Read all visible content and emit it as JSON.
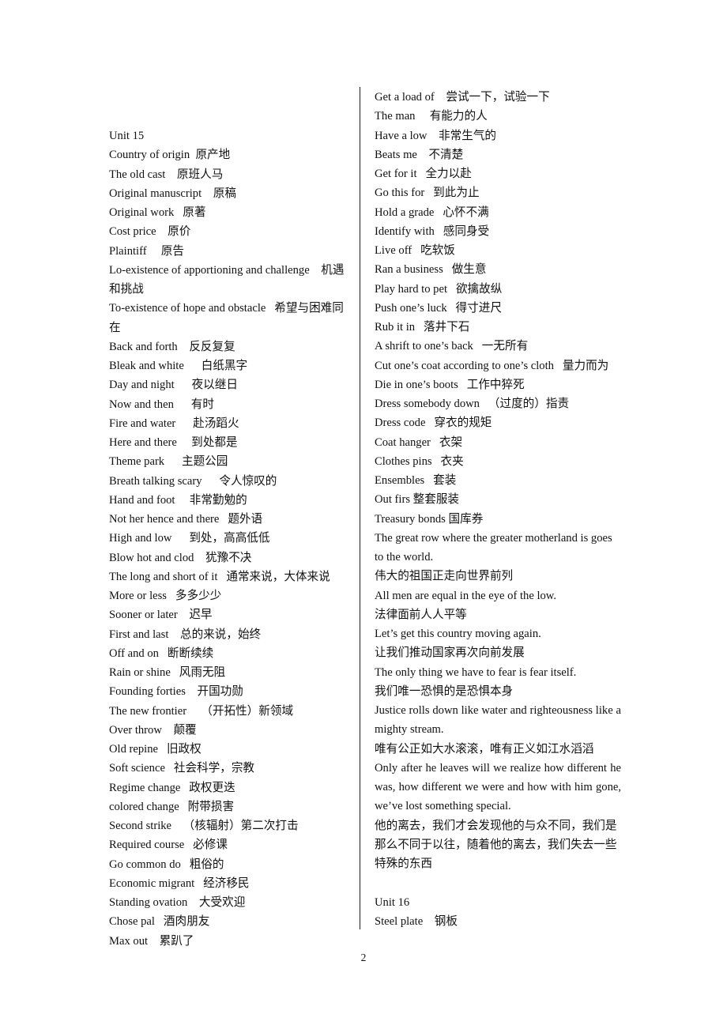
{
  "document": {
    "page_number": "2",
    "columns": {
      "left": {
        "heading": "Unit 15",
        "entries": [
          "Unit 15",
          "Country of origin  原产地",
          "The old cast    原班人马",
          "Original manuscript    原稿",
          "Original work   原著",
          "Cost price    原价",
          "Plaintiff     原告",
          "Lo-existence of apportioning and challenge    机遇和挑战",
          "To-existence of hope and obstacle   希望与困难同在",
          "Back and forth    反反复复",
          "Bleak and white      白纸黑字",
          "Day and night      夜以继日",
          "Now and then      有时",
          "Fire and water      赴汤蹈火",
          "Here and there     到处都是",
          "Theme park      主题公园",
          "Breath talking scary      令人惊叹的",
          "Hand and foot     非常勤勉的",
          "Not her hence and there   题外语",
          "High and low      到处，高高低低",
          "Blow hot and clod    犹豫不决",
          "The long and short of it   通常来说，大体来说",
          "More or less   多多少少",
          "Sooner or later    迟早",
          "First and last    总的来说，始终",
          "Off and on   断断续续",
          "Rain or shine   风雨无阻",
          "Founding forties    开国功勋",
          "The new frontier     （开拓性）新领域",
          "Over throw    颠覆",
          "Old repine   旧政权",
          "Soft science   社会科学，宗教",
          "Regime change   政权更迭",
          "colored change   附带损害",
          "Second strike    （核辐射）第二次打击",
          "Required course   必修课",
          "Go common do   粗俗的",
          "Economic migrant   经济移民",
          "Standing ovation    大受欢迎",
          "Chose pal   酒肉朋友",
          "Max out    累趴了"
        ]
      },
      "right": {
        "heading": "Unit 16",
        "entries": [
          {
            "type": "line",
            "text": "Get a load of    尝试一下，试验一下"
          },
          {
            "type": "line",
            "text": "The man     有能力的人"
          },
          {
            "type": "line",
            "text": "Have a low    非常生气的"
          },
          {
            "type": "line",
            "text": "Beats me    不清楚"
          },
          {
            "type": "line",
            "text": "Get for it   全力以赴"
          },
          {
            "type": "line",
            "text": "Go this for   到此为止"
          },
          {
            "type": "line",
            "text": "Hold a grade   心怀不满"
          },
          {
            "type": "line",
            "text": "Identify with   感同身受"
          },
          {
            "type": "line",
            "text": "Live off   吃软饭"
          },
          {
            "type": "line",
            "text": "Ran a business   做生意"
          },
          {
            "type": "line",
            "text": "Play hard to pet   欲擒故纵"
          },
          {
            "type": "line",
            "text": "Push one’s luck   得寸进尺"
          },
          {
            "type": "line",
            "text": "Rub it in   落井下石"
          },
          {
            "type": "line",
            "text": "A shrift to one’s back   一无所有"
          },
          {
            "type": "line",
            "text": "Cut one’s coat according to one’s cloth   量力而为"
          },
          {
            "type": "line",
            "text": "Die in one’s boots   工作中猝死"
          },
          {
            "type": "line",
            "text": "Dress somebody down   （过度的）指责"
          },
          {
            "type": "line",
            "text": "Dress code   穿衣的规矩"
          },
          {
            "type": "line",
            "text": "Coat hanger   衣架"
          },
          {
            "type": "line",
            "text": "Clothes pins   衣夹"
          },
          {
            "type": "line",
            "text": "Ensembles   套装"
          },
          {
            "type": "line",
            "text": "Out firs 整套服装"
          },
          {
            "type": "line",
            "text": "Treasury bonds 国库券"
          },
          {
            "type": "para",
            "text": "The great row where the greater motherland is goes to the world."
          },
          {
            "type": "line",
            "text": "伟大的祖国正走向世界前列"
          },
          {
            "type": "line",
            "text": "All men are equal in the eye of the low."
          },
          {
            "type": "line",
            "text": "法律面前人人平等"
          },
          {
            "type": "line",
            "text": "Let’s get this country moving again."
          },
          {
            "type": "line",
            "text": "让我们推动国家再次向前发展"
          },
          {
            "type": "line",
            "text": "The only thing we have to fear is fear itself."
          },
          {
            "type": "line",
            "text": "我们唯一恐惧的是恐惧本身"
          },
          {
            "type": "para-justify",
            "text": "Justice rolls down like water and righteousness like a mighty stream."
          },
          {
            "type": "line",
            "text": "唯有公正如大水滚滚，唯有正义如江水滔滔"
          },
          {
            "type": "para-justify",
            "text": "Only after he leaves will we realize how different he was, how different we were and how with him gone, we’ve lost something special."
          },
          {
            "type": "para",
            "text": "他的离去，我们才会发现他的与众不同，我们是那么不同于以往，随着他的离去，我们失去一些特殊的东西"
          },
          {
            "type": "blank",
            "text": ""
          },
          {
            "type": "line",
            "text": "Unit 16"
          },
          {
            "type": "line",
            "text": "Steel plate    钢板"
          }
        ]
      }
    }
  }
}
